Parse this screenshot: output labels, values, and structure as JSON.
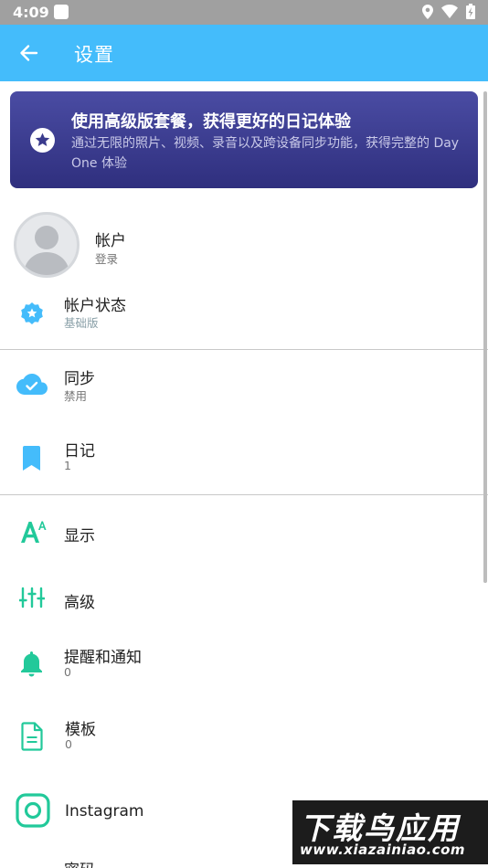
{
  "status_bar": {
    "time": "4:09",
    "icons": [
      "location-icon",
      "wifi-icon",
      "battery-icon"
    ]
  },
  "app_bar": {
    "title": "设置",
    "back_icon": "arrow-back-icon"
  },
  "premium": {
    "title": "使用高级版套餐，获得更好的日记体验",
    "description": "通过无限的照片、视频、录音以及跨设备同步功能，获得完整的 Day One 体验",
    "icon": "star-badge-icon"
  },
  "account": {
    "title": "帐户",
    "subtitle": "登录"
  },
  "account_status": {
    "title": "帐户状态",
    "subtitle": "基础版"
  },
  "sync": {
    "title": "同步",
    "subtitle": "禁用"
  },
  "journals": {
    "title": "日记",
    "subtitle": "1"
  },
  "display": {
    "title": "显示"
  },
  "advanced": {
    "title": "高级"
  },
  "reminders": {
    "title": "提醒和通知",
    "subtitle": "0"
  },
  "templates": {
    "title": "模板",
    "subtitle": "0"
  },
  "instagram": {
    "title": "Instagram"
  },
  "passcode": {
    "title": "密码"
  },
  "watermark": {
    "line1": "下载鸟应用",
    "line2": "www.xiazainiao.com"
  },
  "colors": {
    "app_bar": "#44bcfb",
    "premium_start": "#4a4ca3",
    "premium_end": "#2f2f7e",
    "blue_icon": "#44bcfb",
    "green_icon": "#22c99a"
  }
}
